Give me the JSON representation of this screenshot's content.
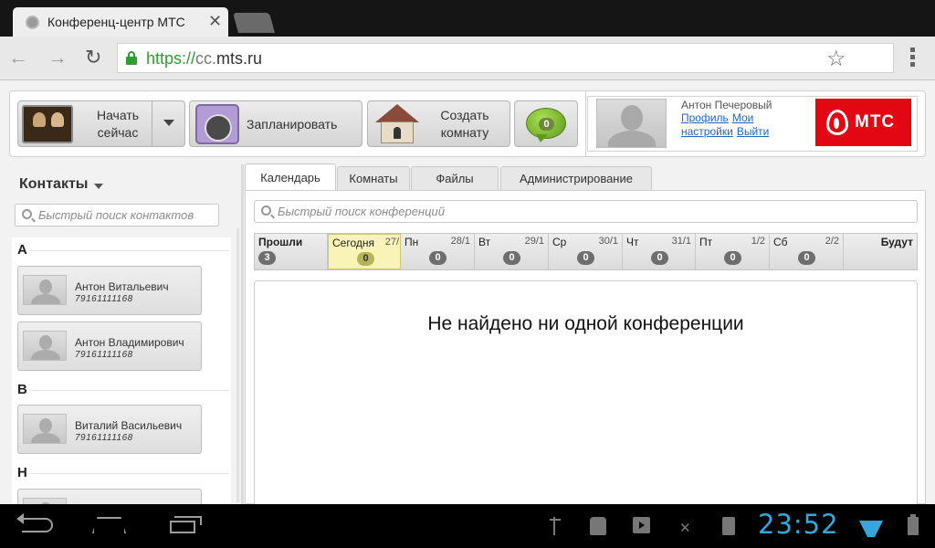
{
  "browser": {
    "tab_title": "Конференц-центр МТС",
    "url_protocol": "https://",
    "url_subdomain": "cc.",
    "url_domain": "mts.ru"
  },
  "toolbar": {
    "start_now_line1": "Начать",
    "start_now_line2": "сейчас",
    "schedule_label": "Запланировать",
    "create_room_line1": "Создать",
    "create_room_line2": "комнату",
    "chat_count": "0"
  },
  "user": {
    "name": "Антон Печеровый",
    "profile_link": "Профиль",
    "settings_link": "Мои настройки",
    "logout_link": "Выйти",
    "logo_text": "МТС"
  },
  "colors": {
    "brand_red": "#e30613",
    "link_blue": "#1e66c3",
    "today_highlight": "#f9f4b6",
    "clock_blue": "#35a7d8"
  },
  "sidebar": {
    "title": "Контакты",
    "search_placeholder": "Быстрый поиск контактов",
    "sections": [
      {
        "letter": "А",
        "contacts": [
          {
            "name": "Антон Витальевич",
            "phone": "79161111168"
          },
          {
            "name": "Антон Владимирович",
            "phone": "79161111168"
          }
        ]
      },
      {
        "letter": "В",
        "contacts": [
          {
            "name": "Виталий Васильевич",
            "phone": "79161111168"
          }
        ]
      },
      {
        "letter": "Н",
        "contacts": []
      }
    ]
  },
  "main": {
    "tabs": [
      {
        "label": "Календарь",
        "active": true
      },
      {
        "label": "Комнаты",
        "active": false
      },
      {
        "label": "Файлы",
        "active": false
      },
      {
        "label": "Администрирование",
        "active": false
      }
    ],
    "search_placeholder": "Быстрый поиск конференций",
    "days": [
      {
        "name": "Прошли",
        "date": "",
        "count": "3"
      },
      {
        "name": "Сегодня",
        "date": "27/",
        "count": "0",
        "today": true
      },
      {
        "name": "Пн",
        "date": "28/1",
        "count": "0"
      },
      {
        "name": "Вт",
        "date": "29/1",
        "count": "0"
      },
      {
        "name": "Ср",
        "date": "30/1",
        "count": "0"
      },
      {
        "name": "Чт",
        "date": "31/1",
        "count": "0"
      },
      {
        "name": "Пт",
        "date": "1/2",
        "count": "0"
      },
      {
        "name": "Сб",
        "date": "2/2",
        "count": "0"
      },
      {
        "name": "Будут",
        "date": "",
        "count": ""
      }
    ],
    "empty_message": "Не найдено ни одной конференции"
  },
  "statusbar": {
    "time": "23:52",
    "icons": [
      "usb-icon",
      "android-debug-icon",
      "play-store-icon",
      "tethering-icon",
      "sd-card-icon",
      "wifi-icon",
      "battery-icon"
    ]
  },
  "navbar": {
    "icons": [
      "back-icon",
      "home-icon",
      "recent-apps-icon"
    ]
  }
}
